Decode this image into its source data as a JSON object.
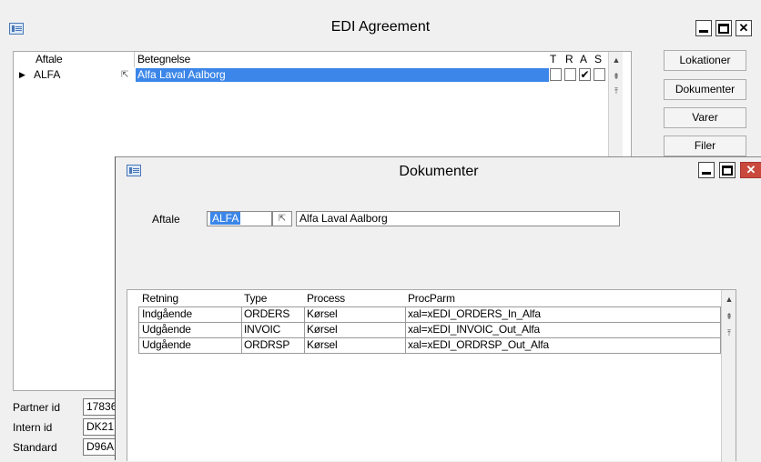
{
  "edi_window": {
    "title": "EDI Agreement",
    "grid": {
      "headers": {
        "aftale": "Aftale",
        "betegnelse": "Betegnelse",
        "t": "T",
        "r": "R",
        "a": "A",
        "s": "S"
      },
      "rows": [
        {
          "aftale": "ALFA",
          "betegnelse": "Alfa Laval Aalborg",
          "t": false,
          "r": false,
          "a": true,
          "s": false
        }
      ]
    },
    "buttons": {
      "lokationer": "Lokationer",
      "dokumenter": "Dokumenter",
      "varer": "Varer",
      "filer": "Filer"
    },
    "info": {
      "partner_label": "Partner id",
      "partner_value": "17836",
      "intern_label": "Intern id",
      "intern_value": "DK21",
      "standard_label": "Standard",
      "standard_value": "D96A"
    }
  },
  "dok_window": {
    "title": "Dokumenter",
    "aftale_label": "Aftale",
    "aftale_code": "ALFA",
    "aftale_name": "Alfa Laval Aalborg",
    "grid": {
      "headers": {
        "retning": "Retning",
        "type": "Type",
        "process": "Process",
        "procparm": "ProcParm"
      },
      "rows": [
        {
          "retning": "Indgående",
          "type": "ORDERS",
          "process": "Kørsel",
          "procparm": "xal=xEDI_ORDERS_In_Alfa"
        },
        {
          "retning": "Udgående",
          "type": "INVOIC",
          "process": "Kørsel",
          "procparm": "xal=xEDI_INVOIC_Out_Alfa"
        },
        {
          "retning": "Udgående",
          "type": "ORDRSP",
          "process": "Kørsel",
          "procparm": "xal=xEDI_ORDRSP_Out_Alfa"
        }
      ]
    }
  },
  "colors": {
    "selection": "#3b86e8",
    "close_red": "#c94a3c"
  }
}
